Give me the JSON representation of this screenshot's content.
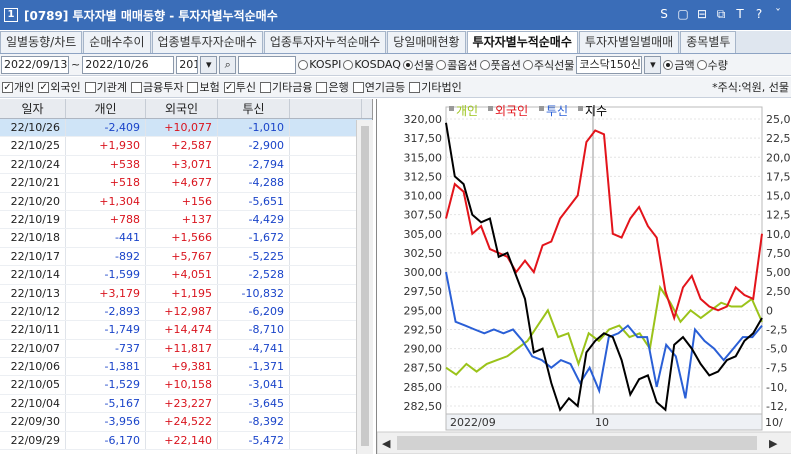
{
  "window": {
    "number": "1",
    "title": "[0789] 투자자별 매매동향 - 투자자별누적순매수",
    "icons": [
      "S",
      "▢",
      "⊟",
      "⧉",
      "T",
      "?",
      "ˇ"
    ]
  },
  "tabs": [
    "일별동향/차트",
    "순매수추이",
    "업종별투자자순매수",
    "업종투자자누적순매수",
    "당일매매현황",
    "투자자별누적순매수",
    "투자자별일별매매",
    "종목별투"
  ],
  "active_tab": 5,
  "controls": {
    "start_date": "2022/09/13",
    "tilde": "~",
    "end_date": "2022/10/26",
    "count": "201",
    "radios": [
      {
        "label": "KOSPI",
        "on": false
      },
      {
        "label": "KOSDAQ",
        "on": false
      },
      {
        "label": "선물",
        "on": true
      },
      {
        "label": "콜옵션",
        "on": false
      },
      {
        "label": "풋옵션",
        "on": false
      },
      {
        "label": "주식선물",
        "on": false
      }
    ],
    "market_select": "코스닥150신",
    "amount_radios": [
      {
        "label": "금액",
        "on": true
      },
      {
        "label": "수량",
        "on": false
      }
    ]
  },
  "filters": [
    {
      "label": "개인",
      "on": true
    },
    {
      "label": "외국인",
      "on": true
    },
    {
      "label": "기관계",
      "on": false
    },
    {
      "label": "금융투자",
      "on": false
    },
    {
      "label": "보험",
      "on": false
    },
    {
      "label": "투신",
      "on": true
    },
    {
      "label": "기타금융",
      "on": false
    },
    {
      "label": "은행",
      "on": false
    },
    {
      "label": "연기금등",
      "on": false
    },
    {
      "label": "기타법인",
      "on": false
    }
  ],
  "unit_note": "*주식:억원, 선물",
  "table": {
    "headers": [
      "일자",
      "개인",
      "외국인",
      "투신"
    ],
    "rows": [
      [
        "22/10/26",
        "-2,409",
        "+10,077",
        "-1,010"
      ],
      [
        "22/10/25",
        "+1,930",
        "+2,587",
        "-2,900"
      ],
      [
        "22/10/24",
        "+538",
        "+3,071",
        "-2,794"
      ],
      [
        "22/10/21",
        "+518",
        "+4,677",
        "-4,288"
      ],
      [
        "22/10/20",
        "+1,304",
        "+156",
        "-5,651"
      ],
      [
        "22/10/19",
        "+788",
        "+137",
        "-4,429"
      ],
      [
        "22/10/18",
        "-441",
        "+1,566",
        "-1,672"
      ],
      [
        "22/10/17",
        "-892",
        "+5,767",
        "-5,225"
      ],
      [
        "22/10/14",
        "-1,599",
        "+4,051",
        "-2,528"
      ],
      [
        "22/10/13",
        "+3,179",
        "+1,195",
        "-10,832"
      ],
      [
        "22/10/12",
        "-2,893",
        "+12,987",
        "-6,209"
      ],
      [
        "22/10/11",
        "-1,749",
        "+14,474",
        "-8,710"
      ],
      [
        "22/10/07",
        "-737",
        "+11,817",
        "-4,741"
      ],
      [
        "22/10/06",
        "-1,381",
        "+9,381",
        "-1,371"
      ],
      [
        "22/10/05",
        "-1,529",
        "+10,158",
        "-3,041"
      ],
      [
        "22/10/04",
        "-5,167",
        "+23,227",
        "-3,645"
      ],
      [
        "22/09/30",
        "-3,956",
        "+24,522",
        "-8,392"
      ],
      [
        "22/09/29",
        "-6,170",
        "+22,140",
        "-5,472"
      ]
    ]
  },
  "chart_data": {
    "type": "line",
    "legend": [
      "개인",
      "외국인",
      "투신",
      "지수"
    ],
    "colors": {
      "개인": "#9bc31a",
      "외국인": "#e3141b",
      "투신": "#2a5fd6",
      "지수": "#000000"
    },
    "left_axis": {
      "ticks": [
        "320,00",
        "317,50",
        "315,00",
        "312,50",
        "310,00",
        "307,50",
        "305,00",
        "302,50",
        "300,00",
        "297,50",
        "295,00",
        "292,50",
        "290,00",
        "287,50",
        "285,00",
        "282,50"
      ],
      "min": 282.5,
      "max": 320
    },
    "right_axis": {
      "ticks": [
        "25,0",
        "22,5",
        "20,0",
        "17,5",
        "15,0",
        "12,5",
        "10,0",
        "7,50",
        "5,00",
        "2,50",
        "0",
        "-2,5",
        "-5,0",
        "-7,5",
        "-10,",
        "-12,"
      ],
      "min": -12.5,
      "max": 25
    },
    "x_labels": [
      "2022/09",
      "10",
      "10/"
    ],
    "series": [
      {
        "name": "개인",
        "axis": "right",
        "values": [
          -7.5,
          -8.4,
          -7.0,
          -8.0,
          -7.0,
          -6.5,
          -6.0,
          -5.0,
          -4.0,
          -2.0,
          0.0,
          -3.5,
          -3.0,
          -7.0,
          -3.0,
          -4.0,
          -2.5,
          -2.0,
          -3.5,
          -3.0,
          -5.0,
          3.0,
          1.0,
          -1.5,
          0.0,
          -1.0,
          0.0,
          1.0,
          0.5,
          0.5,
          1.5,
          -1.5
        ]
      },
      {
        "name": "외국인",
        "axis": "right",
        "values": [
          12.0,
          16.5,
          15.5,
          10.0,
          11.0,
          8.0,
          7.5,
          7.0,
          5.0,
          6.5,
          5.0,
          8.5,
          9.0,
          12.0,
          13.5,
          15.0,
          22.0,
          23.5,
          23.0,
          10.0,
          9.5,
          12.0,
          13.5,
          11.0,
          9.5,
          2.5,
          -1.0,
          3.0,
          4.5,
          1.5,
          0.5,
          0.0,
          0.5,
          3.0,
          2.0,
          1.5,
          10.0
        ]
      },
      {
        "name": "투신",
        "axis": "right",
        "values": [
          5.0,
          -1.5,
          -2.0,
          -2.5,
          -3.0,
          -2.5,
          -3.0,
          -2.5,
          -4.0,
          -6.0,
          -6.5,
          -7.5,
          -6.5,
          -7.0,
          -9.5,
          -7.5,
          -10.5,
          -3.5,
          -3.0,
          -2.0,
          -3.5,
          -3.5,
          -10.0,
          -4.5,
          -6.0,
          -11.5,
          -2.5,
          -4.0,
          -5.0,
          -6.5,
          -5.0,
          -3.5,
          -3.5,
          -2.0
        ]
      },
      {
        "name": "지수",
        "axis": "left",
        "values": [
          319.5,
          312.5,
          311.5,
          307.5,
          306.5,
          307.0,
          302.0,
          302.5,
          299.5,
          296.5,
          289.5,
          290.0,
          285.5,
          282.0,
          283.5,
          282.5,
          289.5,
          291.0,
          292.0,
          291.5,
          288.5,
          284.0,
          286.0,
          286.5,
          283.0,
          282.0,
          290.5,
          291.5,
          290.0,
          288.0,
          286.5,
          287.0,
          288.5,
          289.0,
          291.0,
          292.0,
          294.0
        ]
      }
    ]
  }
}
